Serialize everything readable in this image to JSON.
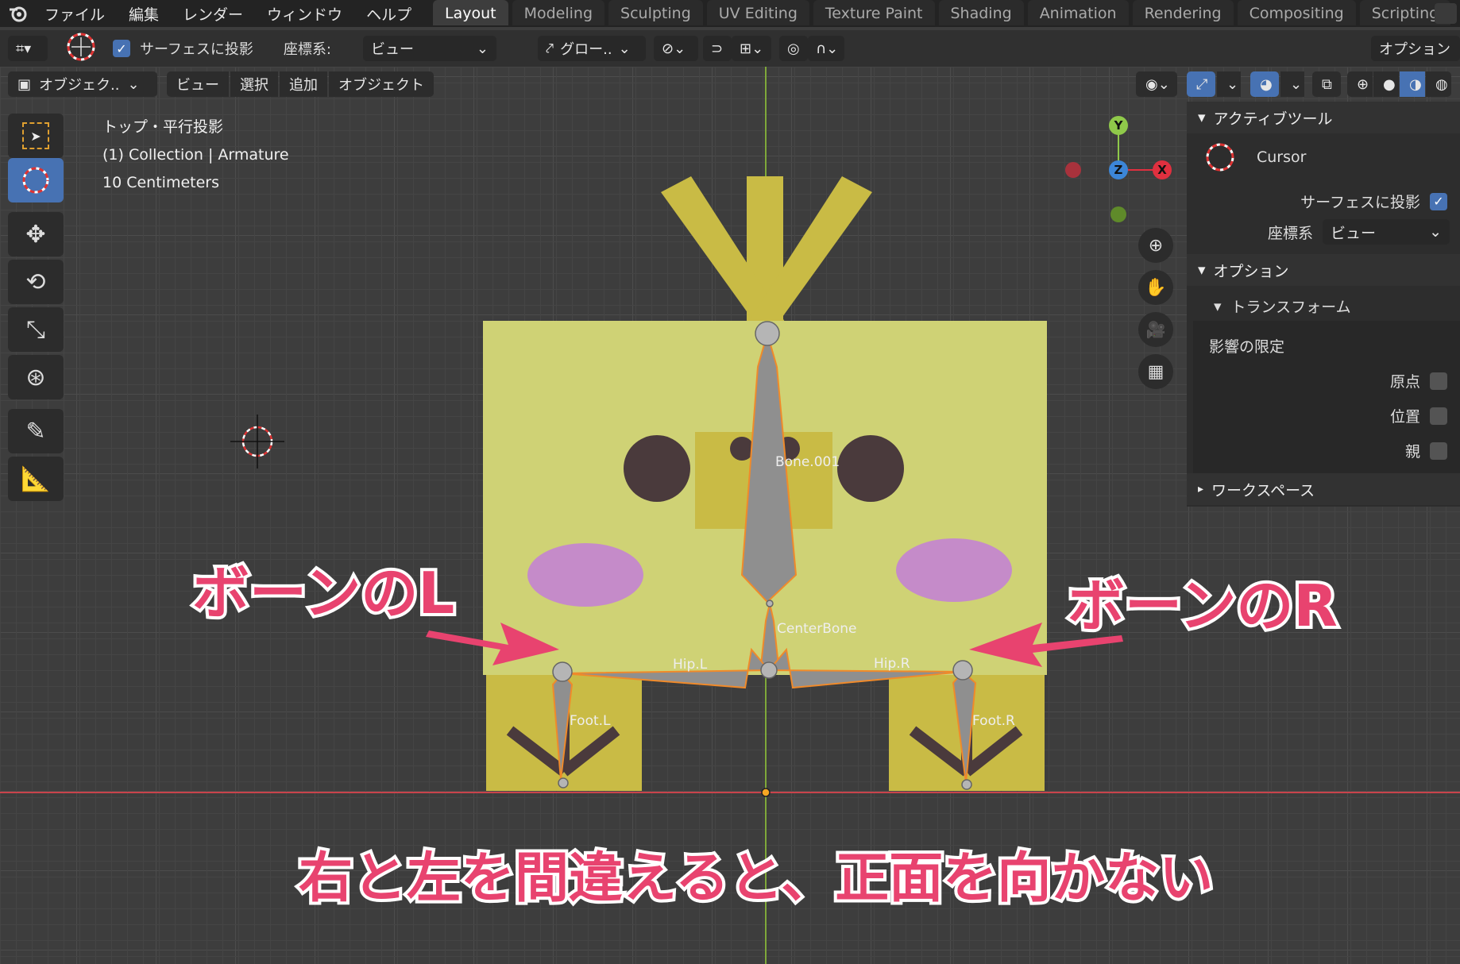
{
  "menu": [
    "ファイル",
    "編集",
    "レンダー",
    "ウィンドウ",
    "ヘルプ"
  ],
  "workspace_tabs": [
    "Layout",
    "Modeling",
    "Sculpting",
    "UV Editing",
    "Texture Paint",
    "Shading",
    "Animation",
    "Rendering",
    "Compositing",
    "Scripting"
  ],
  "active_tab": "Layout",
  "tool_header": {
    "project_label": "サーフェスに投影",
    "coord_label": "座標系:",
    "coord_value": "ビュー",
    "transform_value": "グロー..",
    "options_label": "オプション"
  },
  "view_header": {
    "mode": "オブジェク..",
    "view": "ビュー",
    "select": "選択",
    "add": "追加",
    "object": "オブジェクト"
  },
  "viewport_info": {
    "view_name": "トップ・平行投影",
    "collection": "(1) Collection | Armature",
    "scale": "10 Centimeters"
  },
  "gizmo": {
    "x": "X",
    "y": "Y",
    "z": "Z"
  },
  "bones": {
    "bone001": "Bone.001",
    "center": "CenterBone",
    "hip_l": "Hip.L",
    "hip_r": "Hip.R",
    "foot_l": "Foot.L",
    "foot_r": "Foot.R"
  },
  "panel": {
    "active_tool_header": "アクティブツール",
    "tool_name": "Cursor",
    "project_label": "サーフェスに投影",
    "coord_label": "座標系",
    "coord_value": "ビュー",
    "options_header": "オプション",
    "transform_header": "トランスフォーム",
    "limit_label": "影響の限定",
    "origin_label": "原点",
    "location_label": "位置",
    "parent_label": "親",
    "workspace_header": "ワークスペース"
  },
  "overlay": {
    "bone_l": "ボーンのL",
    "bone_r": "ボーンのR",
    "caption": "右と左を間違えると、正面を向かない"
  },
  "colors": {
    "accent": "#4772b3",
    "body": "#cfd275",
    "dark_yellow": "#c9bb45",
    "cheek": "#c58bc9",
    "eye": "#4a3a3c",
    "annotation": "#e8436f"
  }
}
